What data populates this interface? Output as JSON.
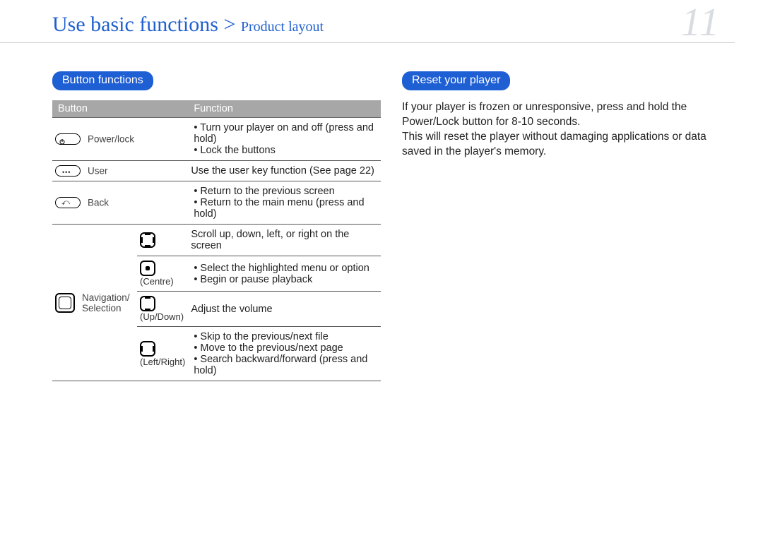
{
  "header": {
    "title": "Use basic functions",
    "separator": " > ",
    "subtitle": "Product layout",
    "page_number": "11"
  },
  "left": {
    "pill": "Button functions",
    "th_button": "Button",
    "th_function": "Function",
    "rows": {
      "power": {
        "label": "Power/lock",
        "f1": "Turn your player on and off (press and hold)",
        "f2": "Lock the buttons"
      },
      "user": {
        "label": "User",
        "f": "Use the user key function (See page 22)"
      },
      "back": {
        "label": "Back",
        "f1": "Return to the previous screen",
        "f2": "Return to the main menu (press and hold)"
      },
      "nav": {
        "label": "Navigation/\nSelection",
        "scroll": {
          "label": "",
          "f": "Scroll up, down, left, or right on the screen"
        },
        "centre": {
          "label": "(Centre)",
          "f1": "Select the highlighted menu or option",
          "f2": "Begin or pause playback"
        },
        "updown": {
          "label": "(Up/Down)",
          "f": "Adjust the volume"
        },
        "leftright": {
          "label": "(Left/Right)",
          "f1": "Skip to the previous/next file",
          "f2": "Move to the previous/next page",
          "f3": "Search backward/forward (press and hold)"
        }
      }
    }
  },
  "right": {
    "pill": "Reset your player",
    "p1": "If your player is frozen or unresponsive, press and hold the Power/Lock button for 8-10 seconds.",
    "p2": "This will reset the player without damaging applications or data saved in the player's memory."
  }
}
